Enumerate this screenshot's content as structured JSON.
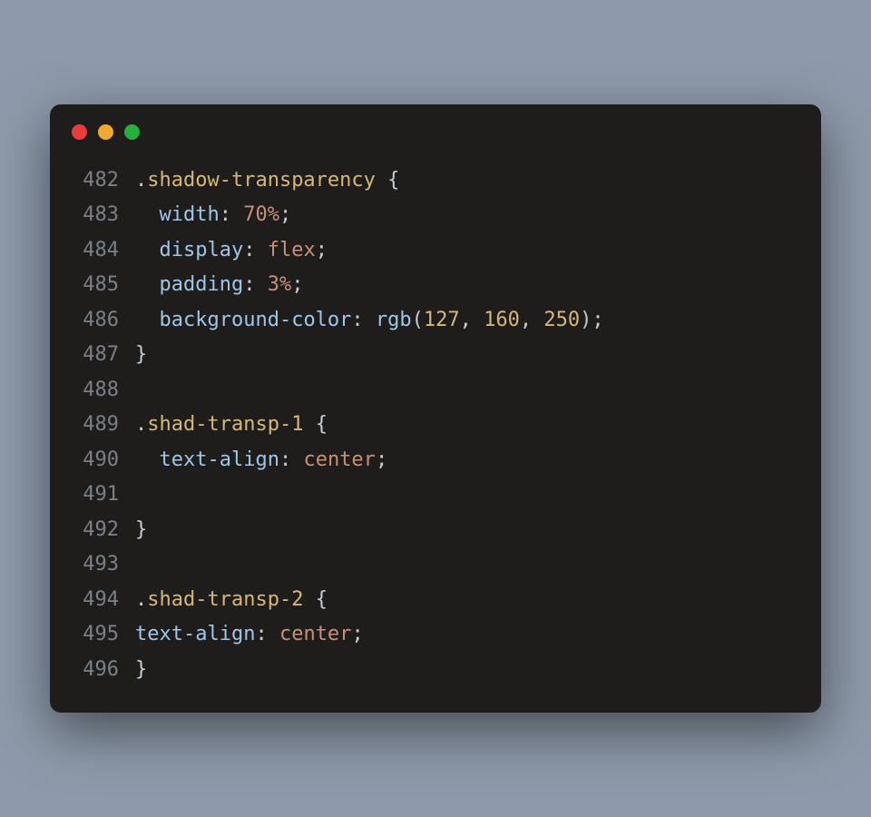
{
  "lines": [
    {
      "num": "482",
      "tokens": [
        {
          "t": ".",
          "c": "dot-sel"
        },
        {
          "t": "shadow-transparency",
          "c": "selector"
        },
        {
          "t": " ",
          "c": "punct"
        },
        {
          "t": "{",
          "c": "punct"
        }
      ]
    },
    {
      "num": "483",
      "tokens": [
        {
          "t": "  ",
          "c": "punct"
        },
        {
          "t": "width",
          "c": "prop"
        },
        {
          "t": ":",
          "c": "colon"
        },
        {
          "t": " ",
          "c": "punct"
        },
        {
          "t": "70%",
          "c": "unit"
        },
        {
          "t": ";",
          "c": "semi"
        }
      ]
    },
    {
      "num": "484",
      "tokens": [
        {
          "t": "  ",
          "c": "punct"
        },
        {
          "t": "display",
          "c": "prop"
        },
        {
          "t": ":",
          "c": "colon"
        },
        {
          "t": " ",
          "c": "punct"
        },
        {
          "t": "flex",
          "c": "unit"
        },
        {
          "t": ";",
          "c": "semi"
        }
      ]
    },
    {
      "num": "485",
      "tokens": [
        {
          "t": "  ",
          "c": "punct"
        },
        {
          "t": "padding",
          "c": "prop"
        },
        {
          "t": ":",
          "c": "colon"
        },
        {
          "t": " ",
          "c": "punct"
        },
        {
          "t": "3%",
          "c": "unit"
        },
        {
          "t": ";",
          "c": "semi"
        }
      ]
    },
    {
      "num": "486",
      "tokens": [
        {
          "t": "  ",
          "c": "punct"
        },
        {
          "t": "background-color",
          "c": "prop"
        },
        {
          "t": ":",
          "c": "colon"
        },
        {
          "t": " ",
          "c": "punct"
        },
        {
          "t": "rgb",
          "c": "func"
        },
        {
          "t": "(",
          "c": "punct"
        },
        {
          "t": "127",
          "c": "num"
        },
        {
          "t": ",",
          "c": "comma"
        },
        {
          "t": " ",
          "c": "punct"
        },
        {
          "t": "160",
          "c": "num"
        },
        {
          "t": ",",
          "c": "comma"
        },
        {
          "t": " ",
          "c": "punct"
        },
        {
          "t": "250",
          "c": "num"
        },
        {
          "t": ")",
          "c": "punct"
        },
        {
          "t": ";",
          "c": "semi"
        }
      ]
    },
    {
      "num": "487",
      "tokens": [
        {
          "t": "}",
          "c": "punct"
        }
      ]
    },
    {
      "num": "488",
      "tokens": []
    },
    {
      "num": "489",
      "tokens": [
        {
          "t": ".",
          "c": "dot-sel"
        },
        {
          "t": "shad-transp-1",
          "c": "selector"
        },
        {
          "t": " ",
          "c": "punct"
        },
        {
          "t": "{",
          "c": "punct"
        }
      ]
    },
    {
      "num": "490",
      "tokens": [
        {
          "t": "  ",
          "c": "punct"
        },
        {
          "t": "text-align",
          "c": "prop"
        },
        {
          "t": ":",
          "c": "colon"
        },
        {
          "t": " ",
          "c": "punct"
        },
        {
          "t": "center",
          "c": "unit"
        },
        {
          "t": ";",
          "c": "semi"
        }
      ]
    },
    {
      "num": "491",
      "tokens": []
    },
    {
      "num": "492",
      "tokens": [
        {
          "t": "}",
          "c": "punct"
        }
      ]
    },
    {
      "num": "493",
      "tokens": []
    },
    {
      "num": "494",
      "tokens": [
        {
          "t": ".",
          "c": "dot-sel"
        },
        {
          "t": "shad-transp-2",
          "c": "selector"
        },
        {
          "t": " ",
          "c": "punct"
        },
        {
          "t": "{",
          "c": "punct"
        }
      ]
    },
    {
      "num": "495",
      "tokens": [
        {
          "t": "text-align",
          "c": "prop"
        },
        {
          "t": ":",
          "c": "colon"
        },
        {
          "t": " ",
          "c": "punct"
        },
        {
          "t": "center",
          "c": "unit"
        },
        {
          "t": ";",
          "c": "semi"
        }
      ]
    },
    {
      "num": "496",
      "tokens": [
        {
          "t": "}",
          "c": "punct"
        }
      ]
    }
  ]
}
